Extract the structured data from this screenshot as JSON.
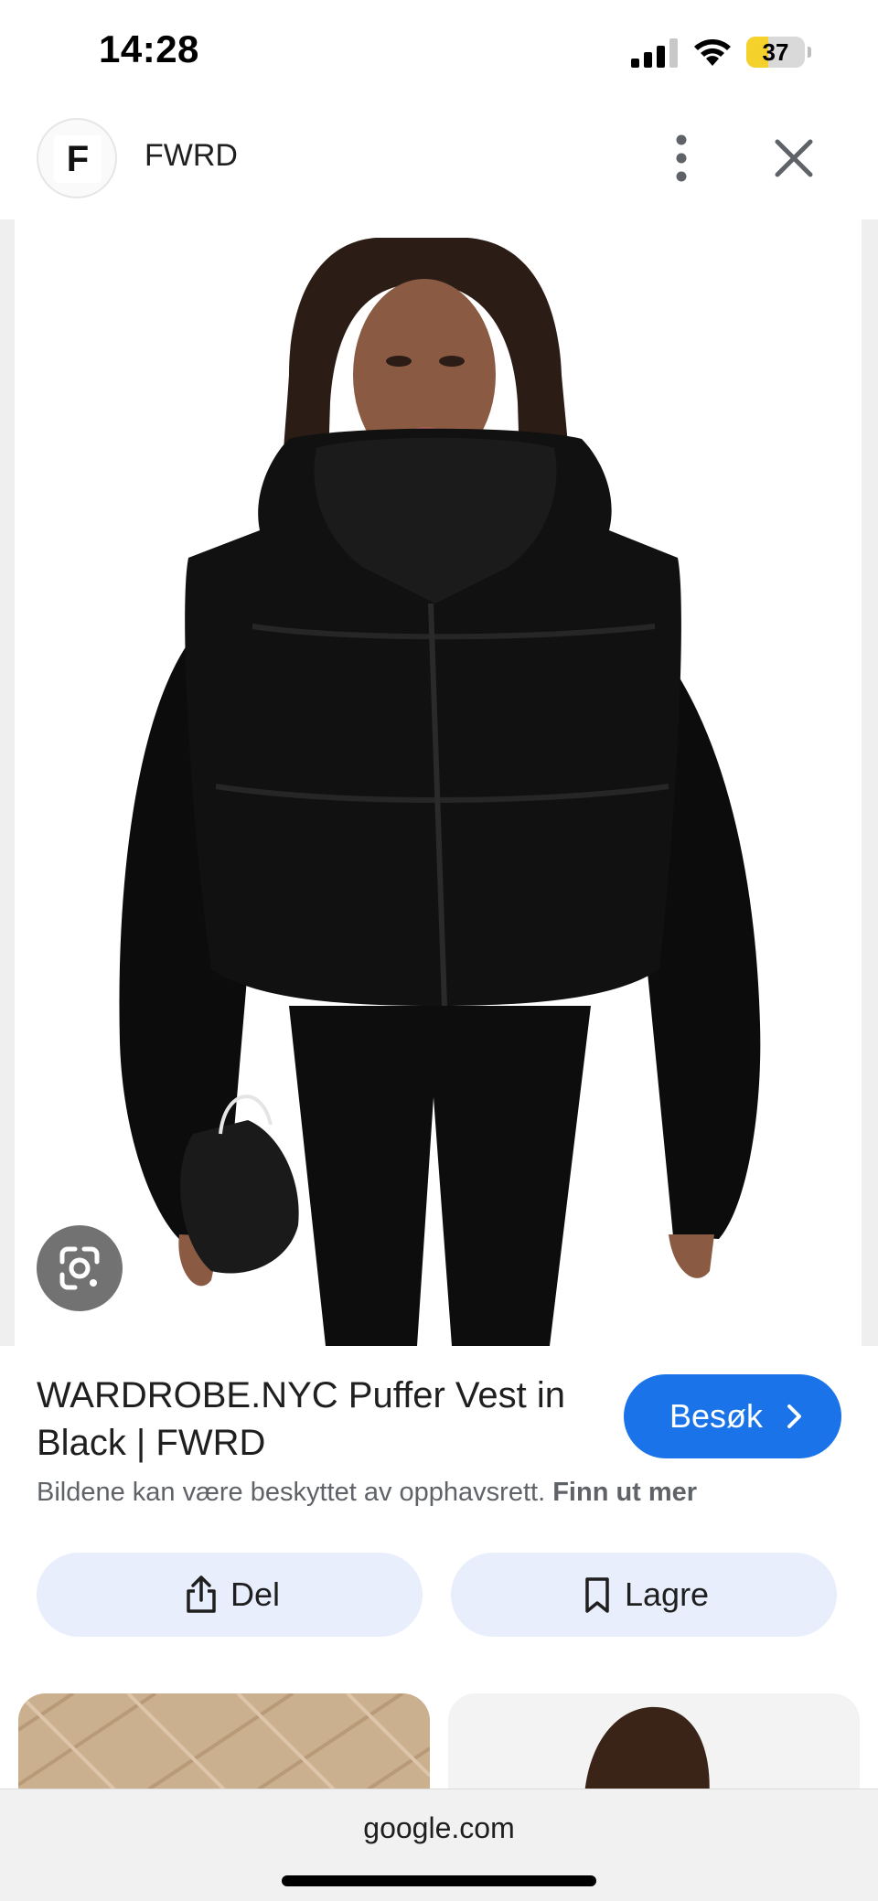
{
  "status_bar": {
    "time": "14:28",
    "battery_level": "37",
    "battery_fraction": 0.37,
    "battery_color": "#f5d22b",
    "icons": [
      "cellular-signal-icon",
      "wifi-icon",
      "battery-icon"
    ]
  },
  "header": {
    "logo_letter": "F",
    "site_name": "FWRD",
    "icons": [
      "more-vert-icon",
      "close-icon"
    ]
  },
  "image": {
    "icons": [
      "google-lens-icon"
    ]
  },
  "product": {
    "title": "WARDROBE.NYC Puffer Vest in Black | FWRD",
    "visit_label": "Besøk",
    "accent_color": "#1a73e8",
    "copyright_text": "Bildene kan være beskyttet av opphavsrett.",
    "copyright_link": "Finn ut mer"
  },
  "actions": {
    "share_label": "Del",
    "save_label": "Lagre"
  },
  "bottom_bar": {
    "url": "google.com"
  }
}
